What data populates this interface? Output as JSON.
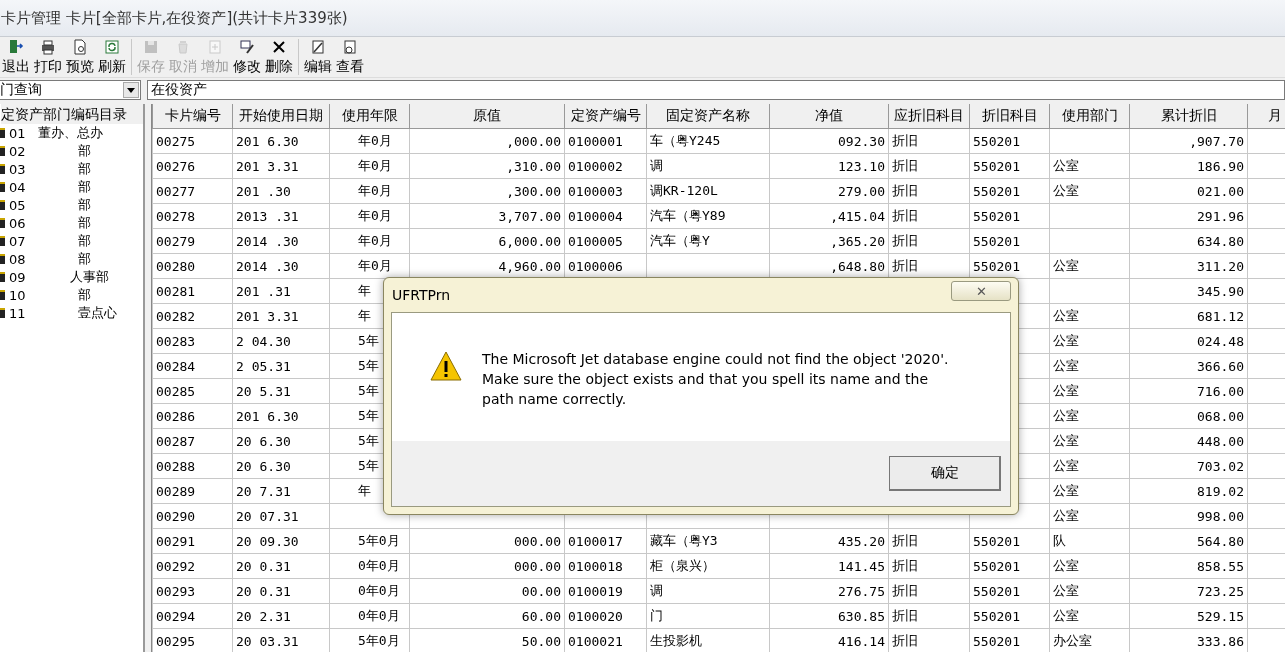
{
  "window": {
    "title": "卡片管理 卡片[全部卡片,在役资产](共计卡片339张)"
  },
  "toolbar": [
    {
      "label": "退出",
      "disabled": false
    },
    {
      "label": "打印",
      "disabled": false
    },
    {
      "label": "预览",
      "disabled": false
    },
    {
      "label": "刷新",
      "disabled": false
    },
    {
      "label": "保存",
      "disabled": true
    },
    {
      "label": "取消",
      "disabled": true
    },
    {
      "label": "增加",
      "disabled": true
    },
    {
      "label": "修改",
      "disabled": false
    },
    {
      "label": "删除",
      "disabled": false
    },
    {
      "label": "编辑",
      "disabled": false
    },
    {
      "label": "查看",
      "disabled": false
    }
  ],
  "query_select": {
    "value": "门查询"
  },
  "filter_field": {
    "value": "在役资产"
  },
  "tree": {
    "title": "定资产部门编码目录",
    "items": [
      {
        "code": "01",
        "name": "董办、总办"
      },
      {
        "code": "02",
        "name": "部"
      },
      {
        "code": "03",
        "name": "部"
      },
      {
        "code": "04",
        "name": "部"
      },
      {
        "code": "05",
        "name": "部"
      },
      {
        "code": "06",
        "name": "部"
      },
      {
        "code": "07",
        "name": "部"
      },
      {
        "code": "08",
        "name": "部"
      },
      {
        "code": "09",
        "name": "人事部"
      },
      {
        "code": "10",
        "name": "部"
      },
      {
        "code": "11",
        "name": "壹点心"
      }
    ]
  },
  "table": {
    "columns": [
      "卡片编号",
      "开始使用日期",
      "使用年限",
      "原值",
      "定资产编号",
      "固定资产名称",
      "净值",
      "应折旧科目",
      "折旧科目",
      "使用部门",
      "累计折旧",
      "月"
    ],
    "rows": [
      {
        "card_no": "00275",
        "start_date": "201 6.30",
        "life": "年0月",
        "original": ",000.00",
        "asset_no": "0100001",
        "asset_name": "车（粤Y245",
        "net": "092.30",
        "account": "折旧",
        "account_code": "550201",
        "accum": ",907.70"
      },
      {
        "card_no": "00276",
        "start_date": "201 3.31",
        "life": "年0月",
        "original": ",310.00",
        "asset_no": "0100002",
        "asset_name": "调",
        "net": "123.10",
        "account": "折旧",
        "account_code": "550201",
        "dept": "公室",
        "accum": "186.90"
      },
      {
        "card_no": "00277",
        "start_date": "201 .30",
        "life": "年0月",
        "original": ",300.00",
        "asset_no": "0100003",
        "asset_name": "调KR-120L",
        "net": "279.00",
        "account": "折旧",
        "account_code": "550201",
        "dept": "公室",
        "accum": "021.00"
      },
      {
        "card_no": "00278",
        "start_date": "2013 .31",
        "life": "年0月",
        "original": "3,707.00",
        "asset_no": "0100004",
        "asset_name": "汽车（粤Y89",
        "net": ",415.04",
        "account": "折旧",
        "account_code": "550201",
        "accum": "291.96"
      },
      {
        "card_no": "00279",
        "start_date": "2014 .30",
        "life": "年0月",
        "original": "6,000.00",
        "asset_no": "0100005",
        "asset_name": "汽车（粤Y",
        "net": ",365.20",
        "account": "折旧",
        "account_code": "550201",
        "accum": "634.80"
      },
      {
        "card_no": "00280",
        "start_date": "2014 .30",
        "life": "年0月",
        "original": "4,960.00",
        "asset_no": "0100006",
        "net": ",648.80",
        "account": "折旧",
        "account_code": "550201",
        "dept": "公室",
        "accum": "311.20"
      },
      {
        "card_no": "00281",
        "start_date": "201 .31",
        "life": "年",
        "accum": "345.90"
      },
      {
        "card_no": "00282",
        "start_date": "201 3.31",
        "life": "年",
        "dept": "公室",
        "accum": "681.12"
      },
      {
        "card_no": "00283",
        "start_date": "2 04.30",
        "life": "5年",
        "dept": "公室",
        "accum": "024.48"
      },
      {
        "card_no": "00284",
        "start_date": "2 05.31",
        "life": "5年",
        "dept": "公室",
        "accum": "366.60"
      },
      {
        "card_no": "00285",
        "start_date": "20 5.31",
        "life": "5年",
        "dept": "公室",
        "accum": "716.00"
      },
      {
        "card_no": "00286",
        "start_date": "201 6.30",
        "life": "5年",
        "dept": "公室",
        "accum": "068.00"
      },
      {
        "card_no": "00287",
        "start_date": "20 6.30",
        "life": "5年",
        "dept": "公室",
        "accum": "448.00"
      },
      {
        "card_no": "00288",
        "start_date": "20 6.30",
        "life": "5年",
        "dept": "公室",
        "accum": "703.02"
      },
      {
        "card_no": "00289",
        "start_date": "20 7.31",
        "life": "年",
        "dept": "公室",
        "accum": "819.02"
      },
      {
        "card_no": "00290",
        "start_date": "20 07.31",
        "dept": "公室",
        "accum": "998.00"
      },
      {
        "card_no": "00291",
        "start_date": "20 09.30",
        "life": "5年0月",
        "original": "000.00",
        "asset_no": "0100017",
        "asset_name": "藏车（粤Y3",
        "net": "435.20",
        "account": "折旧",
        "account_code": "550201",
        "dept": "队",
        "accum": "564.80"
      },
      {
        "card_no": "00292",
        "start_date": "20 0.31",
        "life": "0年0月",
        "original": "000.00",
        "asset_no": "0100018",
        "asset_name": "柜（泉兴）",
        "net": "141.45",
        "account": "折旧",
        "account_code": "550201",
        "dept": "公室",
        "accum": "858.55"
      },
      {
        "card_no": "00293",
        "start_date": "20 0.31",
        "life": "0年0月",
        "original": "00.00",
        "asset_no": "0100019",
        "asset_name": "调",
        "net": "276.75",
        "account": "折旧",
        "account_code": "550201",
        "dept": "公室",
        "accum": "723.25"
      },
      {
        "card_no": "00294",
        "start_date": "20 2.31",
        "life": "0年0月",
        "original": "60.00",
        "asset_no": "0100020",
        "asset_name": "门",
        "net": "630.85",
        "account": "折旧",
        "account_code": "550201",
        "dept": "公室",
        "accum": "529.15"
      },
      {
        "card_no": "00295",
        "start_date": "20 03.31",
        "life": "5年0月",
        "original": "50.00",
        "asset_no": "0100021",
        "asset_name": "生投影机",
        "net": "416.14",
        "account": "折旧",
        "account_code": "550201",
        "dept": "办公室",
        "accum": "333.86"
      }
    ]
  },
  "dialog": {
    "title": "UFRTPrn",
    "close": "✕",
    "message": "The Microsoft Jet database engine could not find the object '2020'.\n Make sure the object exists and that you spell its name and the path name correctly.",
    "ok": "确定"
  }
}
